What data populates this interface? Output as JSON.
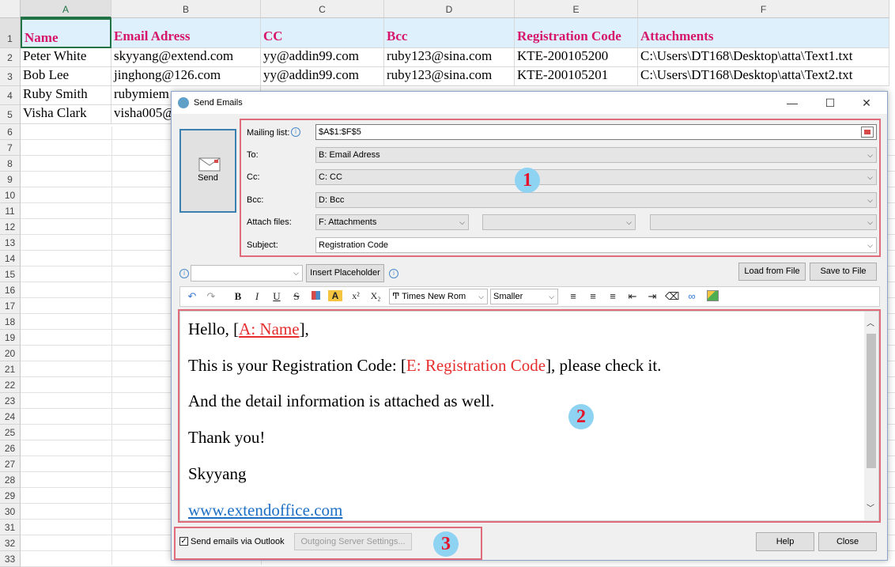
{
  "sheet": {
    "columns": [
      "A",
      "B",
      "C",
      "D",
      "E",
      "F"
    ],
    "row_numbers": [
      "1",
      "2",
      "3",
      "4",
      "5",
      "6",
      "7",
      "8",
      "9",
      "10",
      "11",
      "12",
      "13",
      "14",
      "15",
      "16",
      "17",
      "18",
      "19",
      "20",
      "21",
      "22",
      "23",
      "24",
      "25",
      "26",
      "27",
      "28",
      "29",
      "30",
      "31",
      "32",
      "33"
    ],
    "headers": [
      "Name",
      "Email Adress",
      "CC",
      "Bcc",
      "Registration Code",
      "Attachments"
    ],
    "rows": [
      [
        "Peter White",
        "skyyang@extend.com",
        "yy@addin99.com",
        "ruby123@sina.com",
        "KTE-200105200",
        "C:\\Users\\DT168\\Desktop\\atta\\Text1.txt"
      ],
      [
        "Bob Lee",
        "jinghong@126.com",
        "yy@addin99.com",
        "ruby123@sina.com",
        "KTE-200105201",
        "C:\\Users\\DT168\\Desktop\\atta\\Text2.txt"
      ],
      [
        "Ruby Smith",
        "rubymiem",
        "",
        "",
        "",
        ""
      ],
      [
        "Visha Clark",
        "visha005@",
        "",
        "",
        "",
        ""
      ]
    ]
  },
  "dialog": {
    "title": "Send Emails",
    "window_buttons": {
      "minimize": "—",
      "maximize": "☐",
      "close": "✕"
    },
    "send_label": "Send",
    "mailing_list_label": "Mailing list:",
    "mailing_list_value": "$A$1:$F$5",
    "to_label": "To:",
    "to_value": "B: Email Adress",
    "cc_label": "Cc:",
    "cc_value": "C: CC",
    "bcc_label": "Bcc:",
    "bcc_value": "D: Bcc",
    "attach_label": "Attach files:",
    "attach_value": "F: Attachments",
    "subject_label": "Subject:",
    "subject_value": "Registration Code",
    "insert_placeholder": "Insert Placeholder",
    "load_from_file": "Load from File",
    "save_to_file": "Save to File",
    "font_name": "Times New Rom",
    "font_size": "Smaller",
    "body": {
      "line1_prefix": "Hello, [",
      "line1_ph": "A: Name",
      "line1_suffix": "],",
      "line2_prefix": "This is your Registration Code: [",
      "line2_ph": "E: Registration Code",
      "line2_suffix": "], please check it.",
      "line3": "And the detail information is attached as well.",
      "line4": "Thank you!",
      "line5": "Skyyang",
      "line6": "www.extendoffice.com"
    },
    "send_via_outlook": "Send emails via Outlook",
    "send_via_outlook_checked": true,
    "outgoing_server": "Outgoing Server Settings...",
    "help": "Help",
    "close": "Close"
  },
  "callouts": [
    "1",
    "2",
    "3"
  ]
}
